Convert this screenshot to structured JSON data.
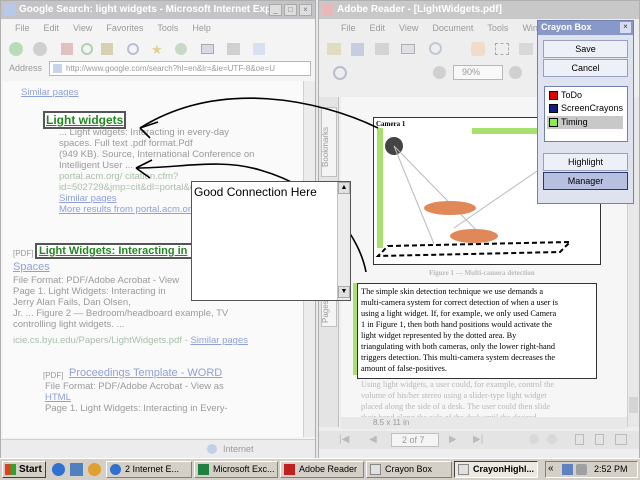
{
  "ie": {
    "title": "Google Search: light widgets - Microsoft Internet Expl...",
    "menu": [
      "File",
      "Edit",
      "View",
      "Favorites",
      "Tools",
      "Help"
    ],
    "address_label": "Address",
    "address": "http://www.google.com/search?hl=en&lr=&ie=UTF-8&oe=U",
    "status": "Internet"
  },
  "results": {
    "similar_top": "Similar pages",
    "r1_title": "Light widgets",
    "r1_line1": "... Light widgets: Interacting in every-day",
    "r1_line2": "spaces. Full text .pdf format.Pdf",
    "r1_line3": "(949 KB). Source, International Conference on",
    "r1_line4": "Intelligent User ...",
    "r1_line5": "portal.acm.org/ citation.cfm?",
    "r1_line6": "id=502729&jmp=cit&dl=portal&dl=...",
    "r1_similar": "Similar pages",
    "r1_more": "More results from portal.acm.org",
    "r2_pdf": "[PDF]",
    "r2_title": "Light Widgets: Interacting in",
    "r2_title2": "Spaces",
    "r2_format": "File Format: PDF/Adobe Acrobat - View",
    "r2_l1": "Page 1. Light Widgets: Interacting in",
    "r2_l2": "Jerry Alan Fails, Dan Olsen,",
    "r2_l3": "Jr. ... Figure 2 — Bedroom/headboard example, TV",
    "r2_l4": "controlling light widgets. ...",
    "r2_url": "icie.cs.byu.edu/Papers/LightWidgets.pdf - ",
    "r2_similar": "Similar pages",
    "r3_pdf": "[PDF]",
    "r3_title": "Proceedings Template - WORD",
    "r3_format": "File Format: PDF/Adobe Acrobat - View as",
    "r3_html": "HTML",
    "r3_l1": "Page 1. Light Widgets: Interacting in Every-"
  },
  "note": {
    "text": "Good Connection Here"
  },
  "reader": {
    "title": "Adobe Reader - [LightWidgets.pdf]",
    "menu": [
      "File",
      "Edit",
      "View",
      "Document",
      "Tools",
      "Window"
    ],
    "zoom": "90%",
    "bookmarks_tab": "Bookmarks",
    "pages_tab": "Pages",
    "figure_label": "Camera 1",
    "caption": "Figure 1 — Multi-camera detection",
    "para_lines": [
      "The simple skin detection technique we use demands a",
      "multi-camera system for correct detection of when a user is",
      "using a light widget. If, for example, we only used Camera",
      "1 in Figure 1, then both hand positions would activate the",
      "light widget represented by the dotted area. By",
      "triangulating with both cameras, only the lower right-hand",
      "triggers detection. This multi-camera system decreases the",
      "amount of false-positives."
    ],
    "faded_lines": [
      "Using light widgets, a user could, for example, control the",
      "volume of his/her stereo using a slider-type light widget",
      "placed along the side of a desk. The user could then slide",
      "their hand along the side of the desk until the desired"
    ],
    "page_size": "8.5 x 11 in",
    "page_nav": "2 of 7"
  },
  "crayon": {
    "title": "Crayon Box",
    "save": "Save",
    "cancel": "Cancel",
    "layers": [
      {
        "name": "ToDo",
        "color": "#e00000"
      },
      {
        "name": "ScreenCrayons",
        "color": "#102080"
      },
      {
        "name": "Timing",
        "color": "#88ee44"
      }
    ],
    "highlight": "Highlight",
    "manager": "Manager"
  },
  "taskbar": {
    "start": "Start",
    "tasks": [
      "2 Internet E...",
      "Microsoft Exc...",
      "Adobe Reader",
      "Crayon Box",
      "CrayonHighl..."
    ],
    "clock": "2:52 PM",
    "chev": "«"
  }
}
